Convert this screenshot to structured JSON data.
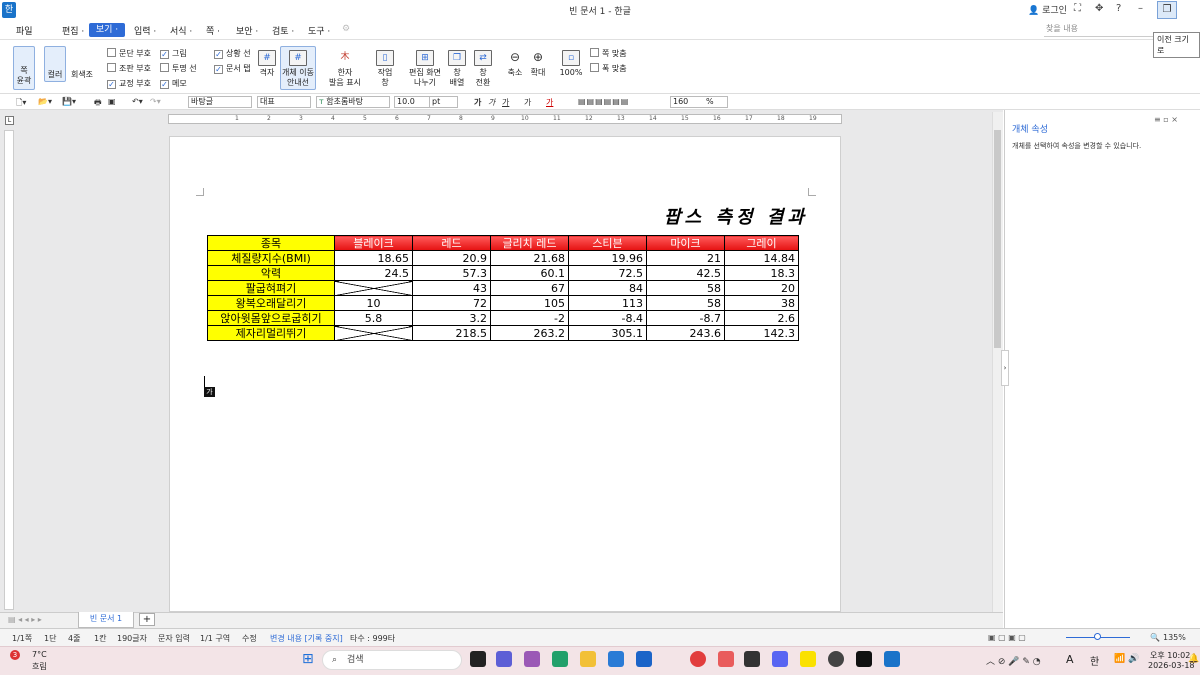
{
  "window": {
    "title": "빈 문서 1 - 한글",
    "login": "로그인",
    "restore_tooltip": "이전 크기로",
    "logo": "한"
  },
  "menu": {
    "items": [
      "파일",
      "편집 ·",
      "보기 ·",
      "입력 ·",
      "서식 ·",
      "쪽 ·",
      "보안 ·",
      "검토 ·",
      "도구 ·"
    ],
    "search_placeholder": "찾을 내용"
  },
  "ribbon": {
    "full_screen": "쪽\n윤곽",
    "color": "컬러",
    "gray": "회색조",
    "checks": [
      {
        "label": "문단 부호",
        "checked": false
      },
      {
        "label": "조판 부호",
        "checked": false
      },
      {
        "label": "교정 부호",
        "checked": true
      },
      {
        "label": "그림",
        "checked": true
      },
      {
        "label": "투명 선",
        "checked": false
      },
      {
        "label": "메모",
        "checked": true
      },
      {
        "label": "상황 선",
        "checked": true
      },
      {
        "label": "문서 탭",
        "checked": true
      }
    ],
    "grid": "격자",
    "obj_guide": "개체 이동\n안내선",
    "hanja": "한자\n발음 표시",
    "workwin": "작업\n창",
    "split": "편집 화면\n나누기",
    "arrange": "창\n배열",
    "switch": "창\n전환",
    "zoom_out": "축소",
    "zoom_in": "확대",
    "zoom_level": "100%",
    "fit_page": "쪽 맞춤",
    "fit_width": "폭 맞춤"
  },
  "format": {
    "style": "바탕글",
    "lang": "대표",
    "font": "함초롬바탕",
    "size": "10.0",
    "unit": "pt",
    "zoom": "160",
    "zoom_unit": "%",
    "bold": "가",
    "italic": "가",
    "underline": "가",
    "strike": "가",
    "color": "가"
  },
  "ruler": {
    "numbers": [
      "1",
      "2",
      "3",
      "4",
      "5",
      "6",
      "7",
      "8",
      "9",
      "10",
      "11",
      "12",
      "13",
      "14",
      "15",
      "16",
      "17",
      "18",
      "19"
    ]
  },
  "document": {
    "title": "팝스 측정 결과",
    "header": [
      "종목",
      "블레이크",
      "레드",
      "글리치 레드",
      "스티븐",
      "마이크",
      "그레이"
    ],
    "rows": [
      {
        "label": "체질량지수(BMI)",
        "values": [
          "18.65",
          "20.9",
          "21.68",
          "19.96",
          "21",
          "14.84"
        ]
      },
      {
        "label": "악력",
        "values": [
          "24.5",
          "57.3",
          "60.1",
          "72.5",
          "42.5",
          "18.3"
        ]
      },
      {
        "label": "팔굽혀펴기",
        "values": [
          null,
          "43",
          "67",
          "84",
          "58",
          "20"
        ]
      },
      {
        "label": "왕복오래달리기",
        "values": [
          "10",
          "72",
          "105",
          "113",
          "58",
          "38"
        ]
      },
      {
        "label": "앉아윗몸앞으로굽히기",
        "values": [
          "5.8",
          "3.2",
          "-2",
          "-8.4",
          "-8.7",
          "2.6"
        ]
      },
      {
        "label": "제자리멀리뛰기",
        "values": [
          null,
          "218.5",
          "263.2",
          "305.1",
          "243.6",
          "142.3"
        ]
      }
    ],
    "ime_indicator": "가"
  },
  "panel": {
    "title": "개체 속성",
    "description": "개체를 선택하여 속성을 변경할 수 있습니다."
  },
  "tabs": {
    "doc_tab": "빈 문서 1",
    "add": "+"
  },
  "status": {
    "items": [
      "1/1쪽",
      "1단",
      "4줄",
      "1칸",
      "190글자",
      "문자 입력",
      "1/1 구역",
      "수정",
      "변경 내용 [기록 중지]",
      "타수 : 999타"
    ],
    "zoom": "135%"
  },
  "taskbar": {
    "weather_temp": "7°C",
    "weather_desc": "흐림",
    "badge": "3",
    "search": "검색",
    "time": "오후 10:02",
    "date": "2026-03-18",
    "ime_a": "A",
    "ime_han": "한"
  }
}
